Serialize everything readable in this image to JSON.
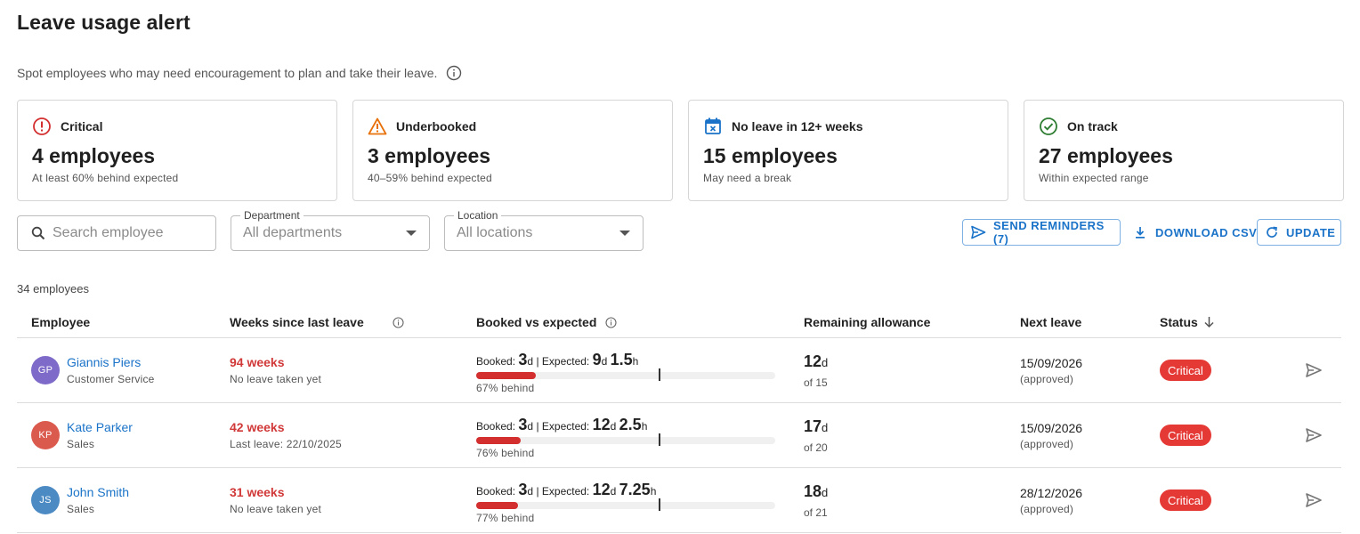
{
  "page": {
    "title": "Leave usage alert",
    "subtitle": "Spot employees who may need encouragement to plan and take their leave."
  },
  "cards": [
    {
      "label": "Critical",
      "value": "4 employees",
      "note": "At least 60% behind expected",
      "icon": "error-circle-icon",
      "color": "#d32f2f"
    },
    {
      "label": "Underbooked",
      "value": "3 employees",
      "note": "40–59% behind expected",
      "icon": "warning-triangle-icon",
      "color": "#e8710a"
    },
    {
      "label": "No leave in 12+ weeks",
      "value": "15 employees",
      "note": "May need a break",
      "icon": "calendar-x-icon",
      "color": "#1a73c8"
    },
    {
      "label": "On track",
      "value": "27 employees",
      "note": "Within expected range",
      "icon": "check-circle-icon",
      "color": "#2e7d32"
    }
  ],
  "filters": {
    "search_placeholder": "Search employee",
    "department_label": "Department",
    "department_value": "All departments",
    "location_label": "Location",
    "location_value": "All locations"
  },
  "actions": {
    "send_reminders": "SEND REMINDERS (7)",
    "download_csv": "DOWNLOAD CSV",
    "update": "UPDATE"
  },
  "employee_count": "34 employees",
  "table": {
    "headers": {
      "employee": "Employee",
      "weeks": "Weeks since last leave",
      "booked": "Booked vs expected",
      "remaining": "Remaining allowance",
      "next": "Next leave",
      "status": "Status"
    },
    "rows": [
      {
        "initials": "GP",
        "avatar_color": "#7e6bc9",
        "name": "Giannis Piers",
        "dept": "Customer Service",
        "weeks": "94 weeks",
        "weeks_note": "No leave taken yet",
        "booked_label": "Booked:",
        "booked_num": "3",
        "booked_unit": "d",
        "expected_label": "| Expected:",
        "expected_d": "9",
        "expected_h": "1.5",
        "booked_frac": 0.2,
        "expected_frac": 0.61,
        "behind": "67% behind",
        "remain_num": "12",
        "remain_unit": "d",
        "remain_of": "of 15",
        "next": "15/09/2026",
        "next_note": "(approved)",
        "status": "Critical"
      },
      {
        "initials": "KP",
        "avatar_color": "#db5a4e",
        "name": "Kate Parker",
        "dept": "Sales",
        "weeks": "42 weeks",
        "weeks_note": "Last leave: 22/10/2025",
        "booked_label": "Booked:",
        "booked_num": "3",
        "booked_unit": "d",
        "expected_label": "| Expected:",
        "expected_d": "12",
        "expected_h": "2.5",
        "booked_frac": 0.15,
        "expected_frac": 0.61,
        "behind": "76% behind",
        "remain_num": "17",
        "remain_unit": "d",
        "remain_of": "of 20",
        "next": "15/09/2026",
        "next_note": "(approved)",
        "status": "Critical"
      },
      {
        "initials": "JS",
        "avatar_color": "#4c8ac4",
        "name": "John Smith",
        "dept": "Sales",
        "weeks": "31 weeks",
        "weeks_note": "No leave taken yet",
        "booked_label": "Booked:",
        "booked_num": "3",
        "booked_unit": "d",
        "expected_label": "| Expected:",
        "expected_d": "12",
        "expected_h": "7.25",
        "booked_frac": 0.14,
        "expected_frac": 0.61,
        "behind": "77% behind",
        "remain_num": "18",
        "remain_unit": "d",
        "remain_of": "of 21",
        "next": "28/12/2026",
        "next_note": "(approved)",
        "status": "Critical"
      }
    ]
  }
}
